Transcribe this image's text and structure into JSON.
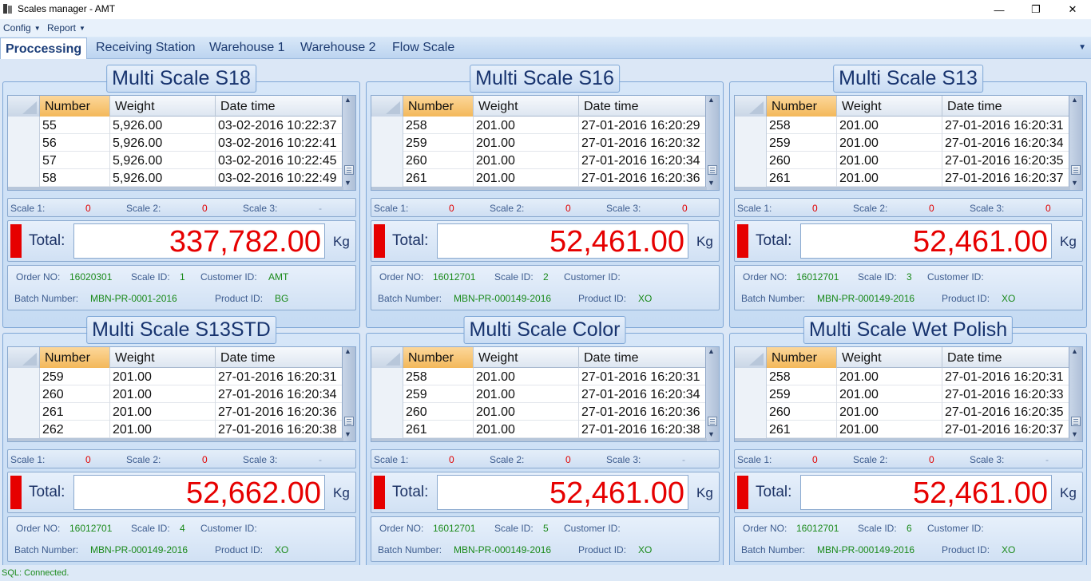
{
  "window": {
    "title": "Scales manager - AMT",
    "minimize_glyph": "—",
    "restore_glyph": "❐",
    "close_glyph": "✕"
  },
  "menu": {
    "items": [
      "Config",
      "Report"
    ],
    "caret": "▼"
  },
  "tabs": {
    "items": [
      "Proccessing",
      "Receiving Station",
      "Warehouse 1",
      "Warehouse 2",
      "Flow Scale"
    ],
    "active": 0,
    "dropdown_glyph": "▼"
  },
  "grid_headers": [
    "Number",
    "Weight",
    "Date time"
  ],
  "scale_labels": [
    "Scale 1:",
    "Scale 2:",
    "Scale 3:"
  ],
  "labels": {
    "total": "Total:",
    "unit": "Kg",
    "order_no": "Order NO:",
    "scale_id": "Scale ID:",
    "customer_id": "Customer ID:",
    "batch_number": "Batch Number:",
    "product_id": "Product ID:"
  },
  "panels": [
    {
      "title": "Multi Scale S18",
      "rows": [
        [
          "55",
          "5,926.00",
          "03-02-2016 10:22:37"
        ],
        [
          "56",
          "5,926.00",
          "03-02-2016 10:22:41"
        ],
        [
          "57",
          "5,926.00",
          "03-02-2016 10:22:45"
        ],
        [
          "58",
          "5,926.00",
          "03-02-2016 10:22:49"
        ]
      ],
      "scales": [
        "0",
        "0",
        "-"
      ],
      "total": "337,782.00",
      "order_no": "16020301",
      "scale_id": "1",
      "customer_id": "AMT",
      "batch_number": "MBN-PR-0001-2016",
      "product_id": "BG"
    },
    {
      "title": "Multi Scale S16",
      "rows": [
        [
          "258",
          "201.00",
          "27-01-2016 16:20:29"
        ],
        [
          "259",
          "201.00",
          "27-01-2016 16:20:32"
        ],
        [
          "260",
          "201.00",
          "27-01-2016 16:20:34"
        ],
        [
          "261",
          "201.00",
          "27-01-2016 16:20:36"
        ]
      ],
      "scales": [
        "0",
        "0",
        "0"
      ],
      "total": "52,461.00",
      "order_no": "16012701",
      "scale_id": "2",
      "customer_id": "",
      "batch_number": "MBN-PR-000149-2016",
      "product_id": "XO"
    },
    {
      "title": "Multi Scale S13",
      "rows": [
        [
          "258",
          "201.00",
          "27-01-2016 16:20:31"
        ],
        [
          "259",
          "201.00",
          "27-01-2016 16:20:34"
        ],
        [
          "260",
          "201.00",
          "27-01-2016 16:20:35"
        ],
        [
          "261",
          "201.00",
          "27-01-2016 16:20:37"
        ]
      ],
      "scales": [
        "0",
        "0",
        "0"
      ],
      "total": "52,461.00",
      "order_no": "16012701",
      "scale_id": "3",
      "customer_id": "",
      "batch_number": "MBN-PR-000149-2016",
      "product_id": "XO"
    },
    {
      "title": "Multi Scale S13STD",
      "rows": [
        [
          "259",
          "201.00",
          "27-01-2016 16:20:31"
        ],
        [
          "260",
          "201.00",
          "27-01-2016 16:20:34"
        ],
        [
          "261",
          "201.00",
          "27-01-2016 16:20:36"
        ],
        [
          "262",
          "201.00",
          "27-01-2016 16:20:38"
        ]
      ],
      "scales": [
        "0",
        "0",
        "-"
      ],
      "total": "52,662.00",
      "order_no": "16012701",
      "scale_id": "4",
      "customer_id": "",
      "batch_number": "MBN-PR-000149-2016",
      "product_id": "XO"
    },
    {
      "title": "Multi Scale Color",
      "rows": [
        [
          "258",
          "201.00",
          "27-01-2016 16:20:31"
        ],
        [
          "259",
          "201.00",
          "27-01-2016 16:20:34"
        ],
        [
          "260",
          "201.00",
          "27-01-2016 16:20:36"
        ],
        [
          "261",
          "201.00",
          "27-01-2016 16:20:38"
        ]
      ],
      "scales": [
        "0",
        "0",
        "-"
      ],
      "total": "52,461.00",
      "order_no": "16012701",
      "scale_id": "5",
      "customer_id": "",
      "batch_number": "MBN-PR-000149-2016",
      "product_id": "XO"
    },
    {
      "title": "Multi Scale Wet Polish",
      "rows": [
        [
          "258",
          "201.00",
          "27-01-2016 16:20:31"
        ],
        [
          "259",
          "201.00",
          "27-01-2016 16:20:33"
        ],
        [
          "260",
          "201.00",
          "27-01-2016 16:20:35"
        ],
        [
          "261",
          "201.00",
          "27-01-2016 16:20:37"
        ]
      ],
      "scales": [
        "0",
        "0",
        "-"
      ],
      "total": "52,461.00",
      "order_no": "16012701",
      "scale_id": "6",
      "customer_id": "",
      "batch_number": "MBN-PR-000149-2016",
      "product_id": "XO"
    }
  ],
  "status": {
    "text": "SQL: Connected."
  },
  "colors": {
    "accent": "#1d3f7a",
    "alarm_red": "#e60000",
    "value_green": "#1a8a1a"
  }
}
